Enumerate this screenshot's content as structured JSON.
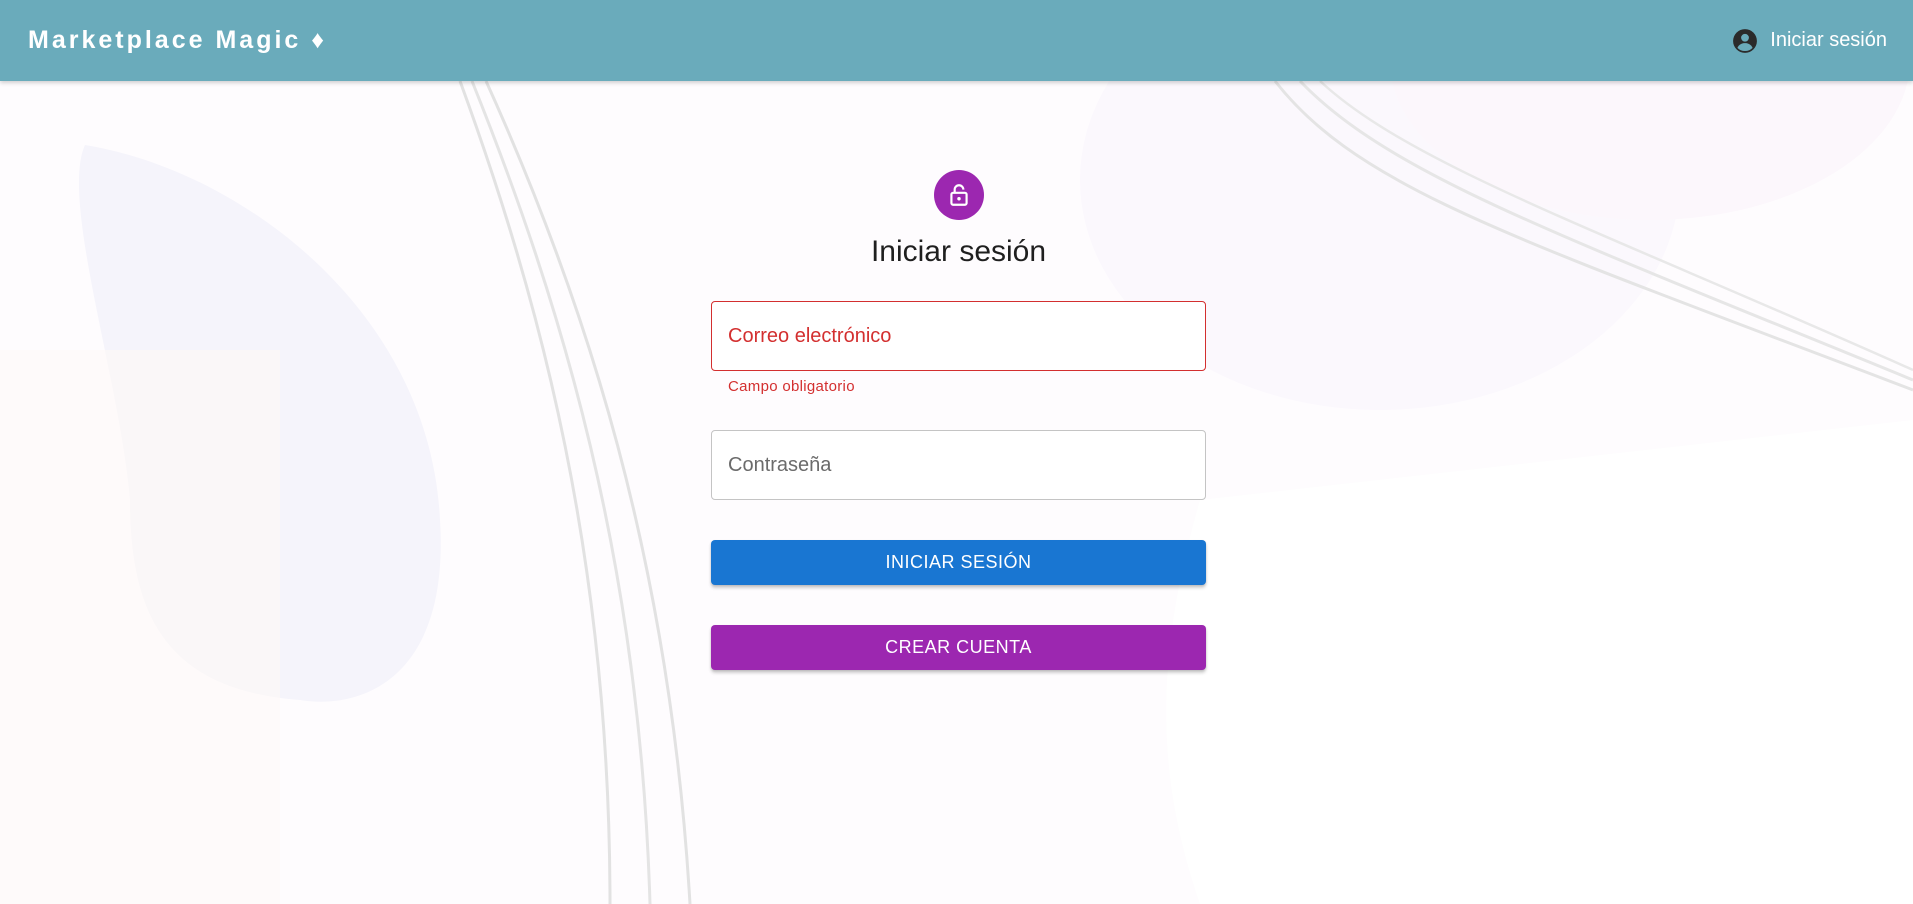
{
  "appbar": {
    "brand": "Marketplace Magic ♦",
    "login_label": "Iniciar sesión",
    "background": "#6aabbb"
  },
  "form": {
    "title": "Iniciar sesión",
    "email_placeholder": "Correo electrónico",
    "email_helper": "Campo obligatorio",
    "password_placeholder": "Contraseña",
    "submit_label": "INICIAR SESIÓN",
    "create_account_label": "CREAR CUENTA"
  },
  "colors": {
    "primary": "#1976d2",
    "secondary": "#9c27b0",
    "error": "#d32f2f"
  },
  "icons": {
    "account": "account-circle-icon",
    "lock": "lock-open-icon"
  }
}
